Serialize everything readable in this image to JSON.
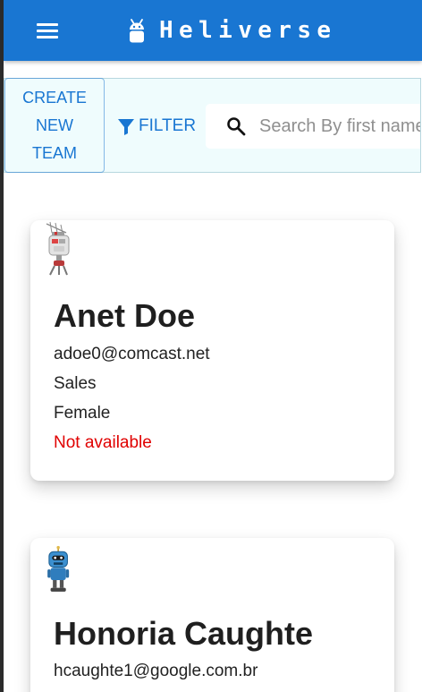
{
  "app": {
    "title": "Heliverse",
    "brand_icon": "android-icon",
    "menu_icon": "hamburger-menu-icon",
    "colors": {
      "primary": "#1976d2",
      "toolbar_background": "#effcfd",
      "unavailable": "#e00000"
    }
  },
  "toolbar": {
    "create_team_label": "CREATE NEW TEAM",
    "create_team_lines": [
      "CREATE",
      "NEW",
      "TEAM"
    ],
    "filter_label": "FILTER",
    "filter_icon": "funnel-icon",
    "search_placeholder": "Search By first name",
    "search_icon": "search-icon"
  },
  "users": [
    {
      "name": "Anet Doe",
      "email": "adoe0@comcast.net",
      "domain": "Sales",
      "gender": "Female",
      "availability": "Not available",
      "avatar": "robot-avatar-antenna"
    },
    {
      "name": "Honoria Caughte",
      "email": "hcaughte1@google.com.br",
      "avatar": "robot-avatar-blue"
    }
  ]
}
